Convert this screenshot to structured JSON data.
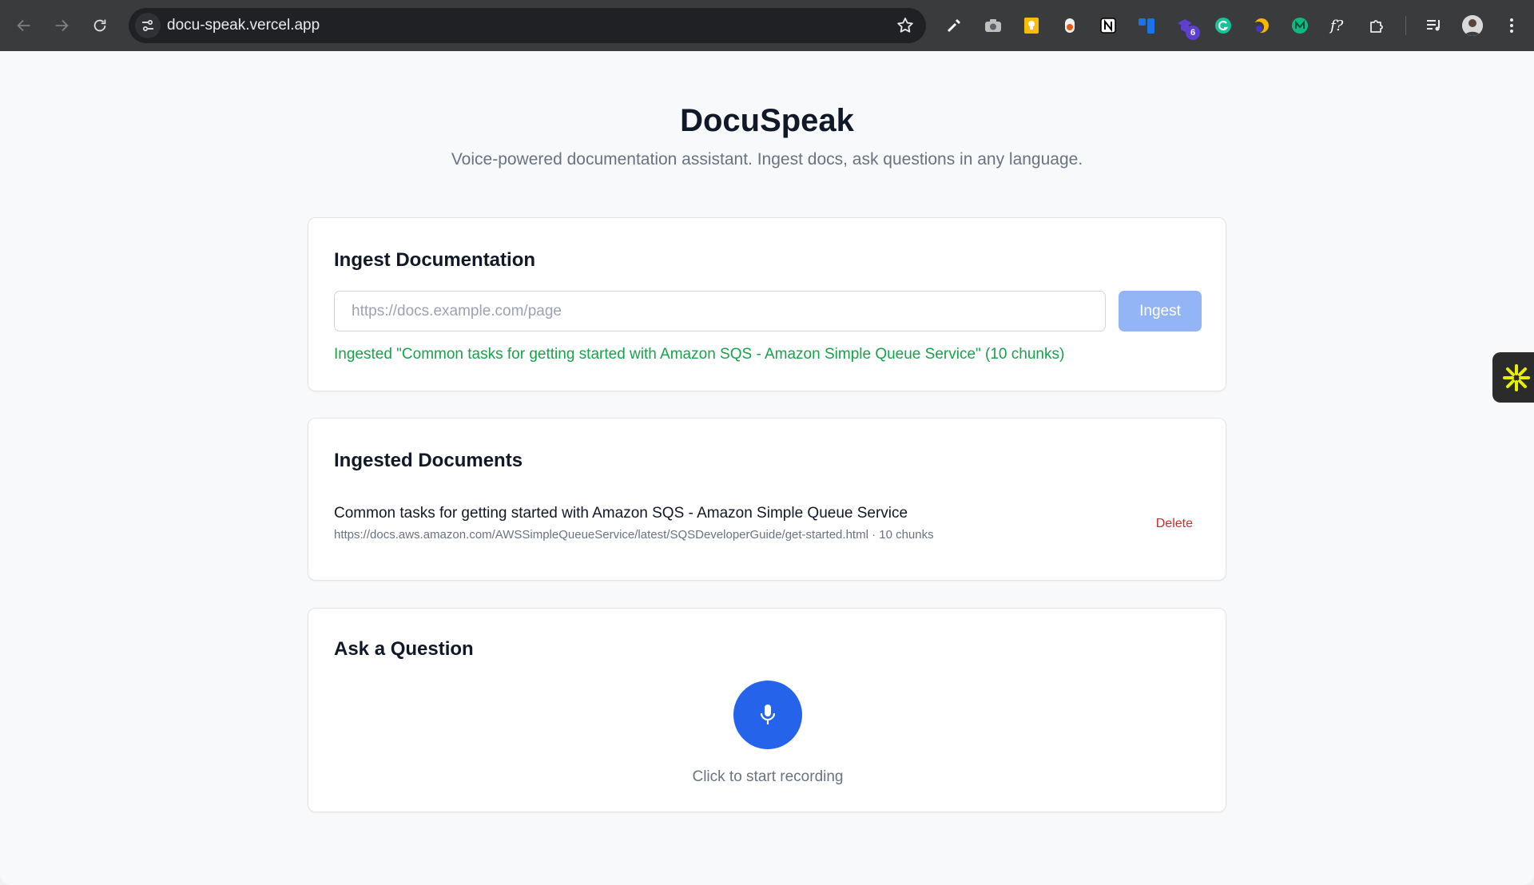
{
  "browser": {
    "url": "docu-speak.vercel.app",
    "extension_badge_count": "6",
    "extensions": [
      "eyedropper-icon",
      "camera-icon",
      "keep-icon",
      "rec-icon",
      "notion-icon",
      "trello-icon",
      "purple-ext-icon",
      "grammarly-icon",
      "moon-ext-icon",
      "teal-ext-icon",
      "formula-icon",
      "puzzle-icon"
    ]
  },
  "header": {
    "title": "DocuSpeak",
    "subtitle": "Voice-powered documentation assistant. Ingest docs, ask questions in any language."
  },
  "ingest": {
    "heading": "Ingest Documentation",
    "url_value": "",
    "url_placeholder": "https://docs.example.com/page",
    "button_label": "Ingest",
    "status_message": "Ingested \"Common tasks for getting started with Amazon SQS - Amazon Simple Queue Service\" (10 chunks)"
  },
  "documents": {
    "heading": "Ingested Documents",
    "items": [
      {
        "title": "Common tasks for getting started with Amazon SQS - Amazon Simple Queue Service",
        "meta": "https://docs.aws.amazon.com/AWSSimpleQueueService/latest/SQSDeveloperGuide/get-started.html · 10 chunks",
        "delete_label": "Delete"
      }
    ]
  },
  "ask": {
    "heading": "Ask a Question",
    "hint": "Click to start recording"
  },
  "colors": {
    "accent": "#2563eb",
    "success": "#16a34a",
    "danger": "#dc2626",
    "ingest_disabled": "#93b4f5"
  }
}
